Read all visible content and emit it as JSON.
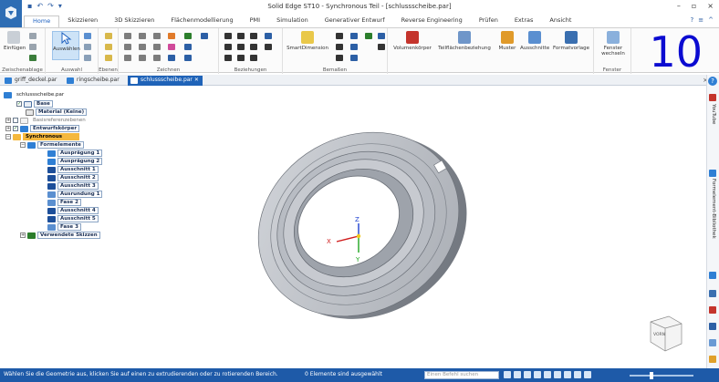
{
  "window": {
    "title": "Solid Edge ST10 - Synchronous Teil - [schlussscheibe.par]",
    "controls": [
      "–",
      "▫",
      "×"
    ]
  },
  "ribbon_tabs": [
    "Home",
    "Skizzieren",
    "3D Skizzieren",
    "Flächenmodellierung",
    "PMI",
    "Simulation",
    "Generativer Entwurf",
    "Reverse Engineering",
    "Prüfen",
    "Extras",
    "Ansicht"
  ],
  "active_tab": "Home",
  "ribbon": {
    "groups": {
      "clipboard": "Zwischenablage",
      "select": "Auswahl",
      "planes": "Ebenen",
      "draw": "Zeichnen",
      "relations": "Beziehungen",
      "dimensions": "Bemaßen",
      "window": "Fenster"
    },
    "buttons": {
      "paste": "Einfügen",
      "select": "Auswählen",
      "smart_dimension": "SmartDimension",
      "body_volume": "Volumenkörper",
      "face_relations": "Teilflächenbeziehung",
      "pattern": "Muster",
      "cutouts": "Ausschnitte",
      "format_template": "Formatvorlage",
      "switch_window_1": "Fenster",
      "switch_window_2": "wechseln"
    },
    "overlay_number": "10"
  },
  "doc_tabs": [
    {
      "label": "griff_deckel.par"
    },
    {
      "label": "ringscheibe.par"
    },
    {
      "label": "schlussscheibe.par",
      "active": true
    }
  ],
  "tree": {
    "root": "schlussscheibe.par",
    "base": "Base",
    "material": "Material (Keine)",
    "base_refs": "Basisreferenzebenen",
    "design_body": "Entwurfskörper",
    "synchronous": "Synchronous",
    "feature_group": "Formelemente",
    "features": [
      "Ausprägung 1",
      "Ausprägung 2",
      "Ausschnitt 1",
      "Ausschnitt 2",
      "Ausschnitt 3",
      "Ausrundung 1",
      "Fase 2",
      "Ausschnitt 4",
      "Ausschnitt 5",
      "Fase 3"
    ],
    "used_sketches": "Verwendete Skizzen"
  },
  "triad": {
    "z": "Z",
    "x": "X",
    "y": "Y"
  },
  "view_cube": {
    "label": "VORN"
  },
  "right_strip": {
    "help": "?",
    "youtube": "YouTube",
    "library": "Formelement-Bibliothek"
  },
  "status": {
    "message": "Wählen Sie die Geometrie aus, klicken Sie auf einen zu extrudierenden oder zu rotierenden Bereich.",
    "selection": "0 Elemente sind ausgewählt",
    "search_placeholder": "Einen Befehl suchen"
  }
}
